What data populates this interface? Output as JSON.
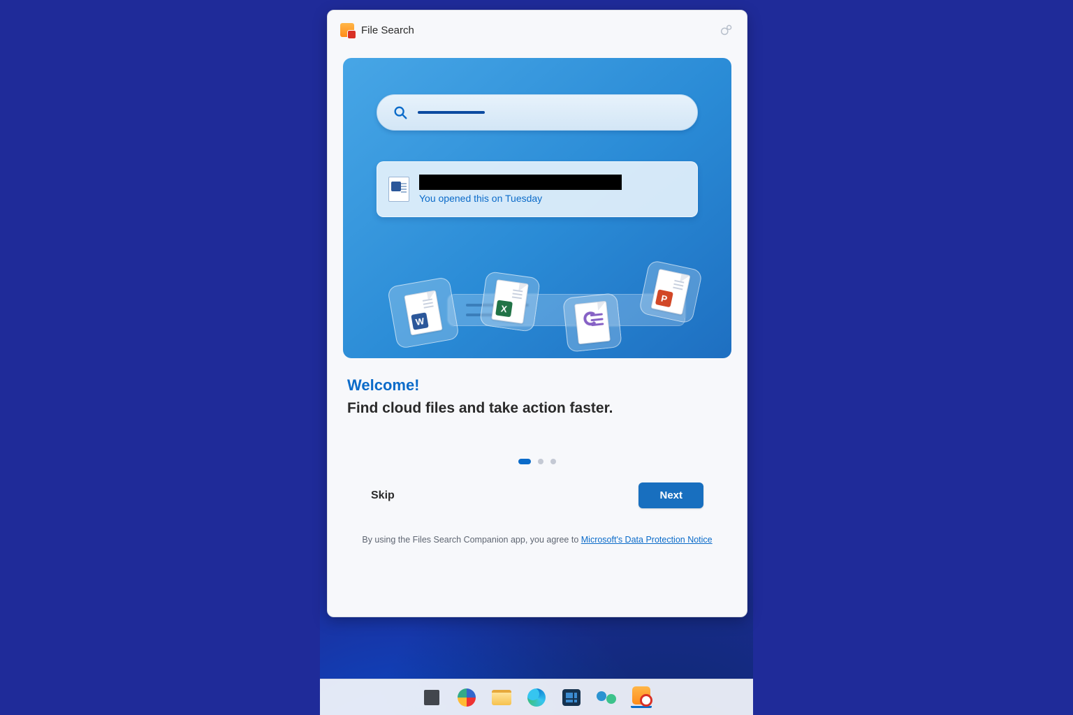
{
  "header": {
    "app_title": "File Search"
  },
  "hero": {
    "result_subtext": "You opened this on Tuesday",
    "doc_icons": [
      "word",
      "excel",
      "loop",
      "powerpoint"
    ]
  },
  "copy": {
    "heading": "Welcome!",
    "subheading": "Find cloud files and take action faster."
  },
  "carousel": {
    "total": 3,
    "active": 0
  },
  "buttons": {
    "skip": "Skip",
    "next": "Next"
  },
  "legal": {
    "prefix": "By using the Files Search Companion app, you agree to ",
    "link_text": "Microsoft's Data Protection Notice"
  },
  "taskbar": {
    "items": [
      "start",
      "copilot",
      "file-explorer",
      "edge",
      "microsoft-store",
      "people",
      "file-search"
    ]
  },
  "colors": {
    "accent": "#0b6bc9",
    "primary_button": "#186fbf",
    "background": "#1f2b99"
  }
}
